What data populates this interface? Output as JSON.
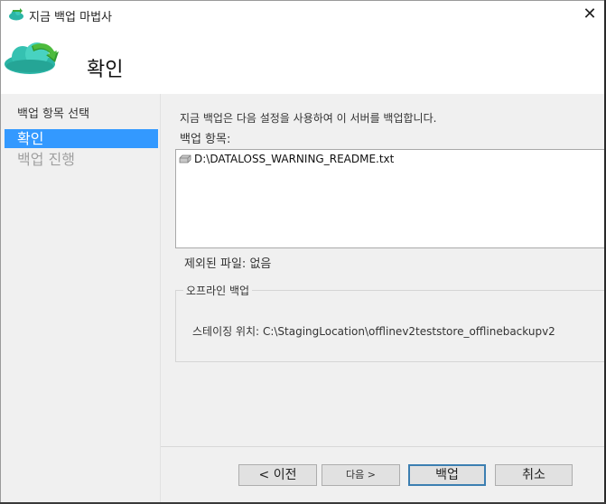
{
  "window": {
    "title": "지금 백업 마법사",
    "close_glyph": "✕"
  },
  "header": {
    "title": "확인",
    "icon": "cloud-backup-arrow-icon"
  },
  "sidebar": {
    "items": [
      {
        "label": "백업 항목 선택",
        "state": "completed"
      },
      {
        "label": "확인",
        "state": "active"
      },
      {
        "label": "백업 진행",
        "state": "disabled"
      }
    ]
  },
  "main": {
    "description": "지금 백업은 다음 설정을 사용하여 이 서버를 백업합니다.",
    "items_label": "백업 항목:",
    "items": [
      {
        "icon": "drive-icon",
        "text": "D:\\DATALOSS_WARNING_README.txt"
      }
    ],
    "excluded_label": "제외된 파일:",
    "excluded_value": "없음",
    "offline_group_title": "오프라인 백업",
    "staging_label": "스테이징 위치:",
    "staging_value": "C:\\StagingLocation\\offlinev2teststore_offlinebackupv2"
  },
  "footer": {
    "prev_label": "< 이전",
    "next_label": "다음 >",
    "backup_label": "백업",
    "cancel_label": "취소"
  },
  "colors": {
    "accent": "#3399ff",
    "panel_bg": "#f0f0f0",
    "cloud_teal": "#2bb5a6",
    "arrow_green": "#3aa83a"
  }
}
